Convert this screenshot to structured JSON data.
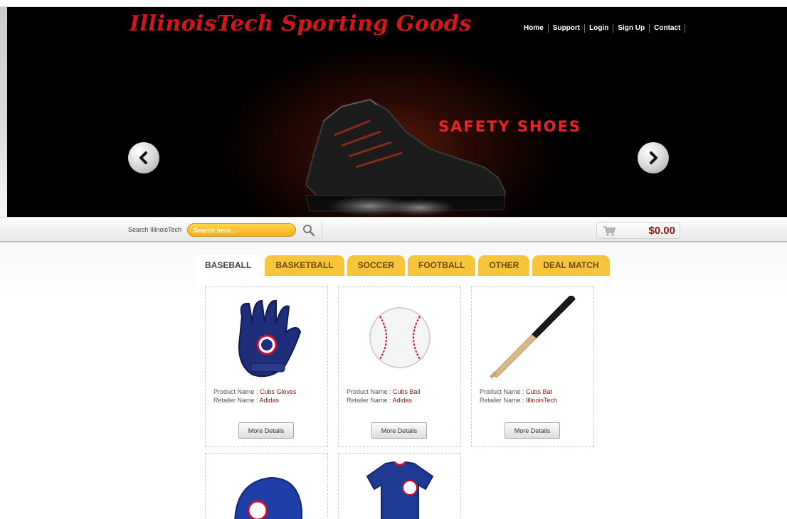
{
  "header": {
    "logo": "IllinoisTech Sporting Goods",
    "nav": [
      "Home",
      "Support",
      "Login",
      "Sign Up",
      "Contact"
    ]
  },
  "banner": {
    "caption": "SAFETY SHOES",
    "prev_icon": "chevron-left-icon",
    "next_icon": "chevron-right-icon"
  },
  "search": {
    "label": "Search IllinoisTech",
    "placeholder": "Search here...",
    "icon": "search-icon"
  },
  "cart": {
    "icon": "shopping-cart-icon",
    "total": "$0.00"
  },
  "tabs": [
    {
      "label": "BASEBALL",
      "active": true
    },
    {
      "label": "BASKETBALL",
      "active": false
    },
    {
      "label": "SOCCER",
      "active": false
    },
    {
      "label": "FOOTBALL",
      "active": false
    },
    {
      "label": "OTHER",
      "active": false
    },
    {
      "label": "DEAL MATCH",
      "active": false
    }
  ],
  "products": [
    {
      "product_label": "Product Name : ",
      "product_name": "Cubs Gloves",
      "retailer_label": "Retailer Name : ",
      "retailer_name": "Adidas",
      "button": "More Details",
      "image": "baseball-glove"
    },
    {
      "product_label": "Product Name : ",
      "product_name": "Cubs Ball",
      "retailer_label": "Retailer Name : ",
      "retailer_name": "Adidas",
      "button": "More Details",
      "image": "baseball"
    },
    {
      "product_label": "Product Name : ",
      "product_name": "Cubs Bat",
      "retailer_label": "Retailer Name : ",
      "retailer_name": "IllinoisTech",
      "button": "More Details",
      "image": "baseball-bat"
    },
    {
      "image": "batting-helmet"
    },
    {
      "image": "cubs-jersey"
    }
  ],
  "colors": {
    "brand_red": "#d4151c",
    "tab_yellow": "#f6c53c",
    "value_red": "#8b1414"
  }
}
